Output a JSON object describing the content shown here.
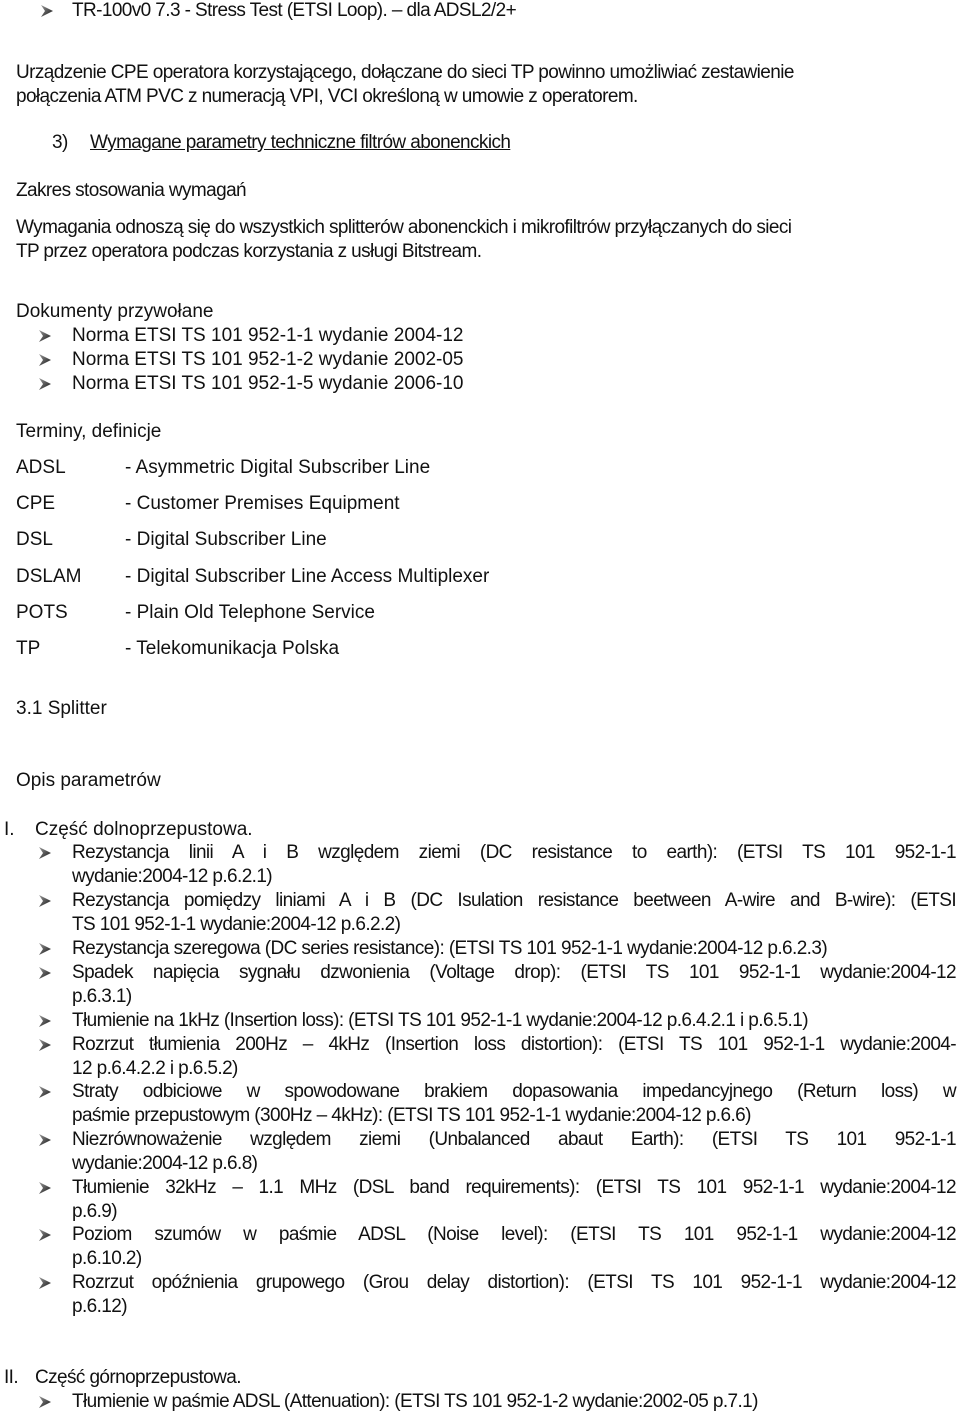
{
  "top_bullet": "TR-100v0 7.3 - Stress Test (ETSI Loop). – dla ADSL2/2+",
  "intro_paragraph": {
    "line1": "Urządzenie CPE operatora korzystającego, dołączane do sieci TP powinno umożliwiać zestawienie",
    "line2": "połączenia ATM PVC z numeracją VPI, VCI określoną w umowie z operatorem."
  },
  "section3": {
    "number": "3)",
    "title": "Wymagane parametry techniczne filtrów abonenckich"
  },
  "scope": {
    "heading": "Zakres stosowania wymagań",
    "line1": "Wymagania odnoszą się do wszystkich splitterów abonenckich i mikrofiltrów przyłączanych do sieci",
    "line2": "TP przez operatora podczas korzystania z usługi Bitstream."
  },
  "referenced_docs": {
    "heading": "Dokumenty przywołane",
    "items": [
      "Norma ETSI TS 101 952-1-1 wydanie 2004-12",
      "Norma ETSI TS 101 952-1-2 wydanie 2002-05",
      "Norma ETSI TS 101 952-1-5 wydanie 2006-10"
    ]
  },
  "terms": {
    "heading": "Terminy, definicje",
    "items": [
      {
        "abbr": "ADSL",
        "def": "- Asymmetric Digital Subscriber Line"
      },
      {
        "abbr": "CPE",
        "def": "- Customer Premises Equipment"
      },
      {
        "abbr": "DSL",
        "def": "- Digital Subscriber Line"
      },
      {
        "abbr": "DSLAM",
        "def": "- Digital Subscriber Line Access Multiplexer"
      },
      {
        "abbr": "POTS",
        "def": "- Plain Old Telephone Service"
      },
      {
        "abbr": "TP",
        "def": "- Telekomunikacja Polska"
      }
    ]
  },
  "splitter": {
    "heading": "3.1 Splitter",
    "params_heading": "Opis parametrów"
  },
  "part1": {
    "numeral": "I.",
    "title": "Część dolnoprzepustowa.",
    "items": [
      {
        "l1": "Rezystancja linii A i B względem ziemi (DC resistance to earth): (ETSI TS 101 952-1-1",
        "l2": "wydanie:2004-12 p.6.2.1)"
      },
      {
        "l1": "Rezystancja pomiędzy liniami A i B (DC Isulation resistance beetween A-wire and B-wire): (ETSI",
        "l2": "TS 101 952-1-1 wydanie:2004-12 p.6.2.2)"
      },
      {
        "l1": "Rezystancja szeregowa (DC series resistance): (ETSI TS 101 952-1-1 wydanie:2004-12 p.6.2.3)",
        "l2": ""
      },
      {
        "l1": "Spadek napięcia sygnału dzwonienia (Voltage drop): (ETSI TS 101 952-1-1 wydanie:2004-12",
        "l2": "p.6.3.1)"
      },
      {
        "l1": "Tłumienie na 1kHz (Insertion loss): (ETSI TS 101 952-1-1 wydanie:2004-12 p.6.4.2.1 i p.6.5.1)",
        "l2": ""
      },
      {
        "l1": "Rozrzut tłumienia 200Hz – 4kHz (Insertion loss distortion): (ETSI TS 101 952-1-1 wydanie:2004-",
        "l2": "12 p.6.4.2.2 i p.6.5.2)"
      },
      {
        "l1": "Straty odbiciowe w spowodowane brakiem dopasowania impedancyjnego (Return loss) w",
        "l2": "paśmie przepustowym (300Hz – 4kHz): (ETSI TS 101 952-1-1 wydanie:2004-12 p.6.6)"
      },
      {
        "l1": "Niezrównoważenie względem ziemi (Unbalanced abaut Earth): (ETSI TS 101 952-1-1",
        "l2": "wydanie:2004-12 p.6.8)"
      },
      {
        "l1": "Tłumienie 32kHz – 1.1 MHz (DSL band requirements): (ETSI TS 101 952-1-1 wydanie:2004-12",
        "l2": "p.6.9)"
      },
      {
        "l1": "Poziom szumów w paśmie ADSL (Noise level): (ETSI TS 101 952-1-1 wydanie:2004-12",
        "l2": "p.6.10.2)"
      },
      {
        "l1": "Rozrzut opóźnienia grupowego (Grou delay distortion): (ETSI TS 101 952-1-1 wydanie:2004-12",
        "l2": "p.6.12)"
      }
    ]
  },
  "part2": {
    "numeral": "II.",
    "title": "Część górnoprzepustowa.",
    "items": [
      {
        "l1": "Tłumienie w paśmie ADSL (Attenuation): (ETSI TS 101 952-1-2 wydanie:2002-05 p.7.1)"
      }
    ]
  }
}
